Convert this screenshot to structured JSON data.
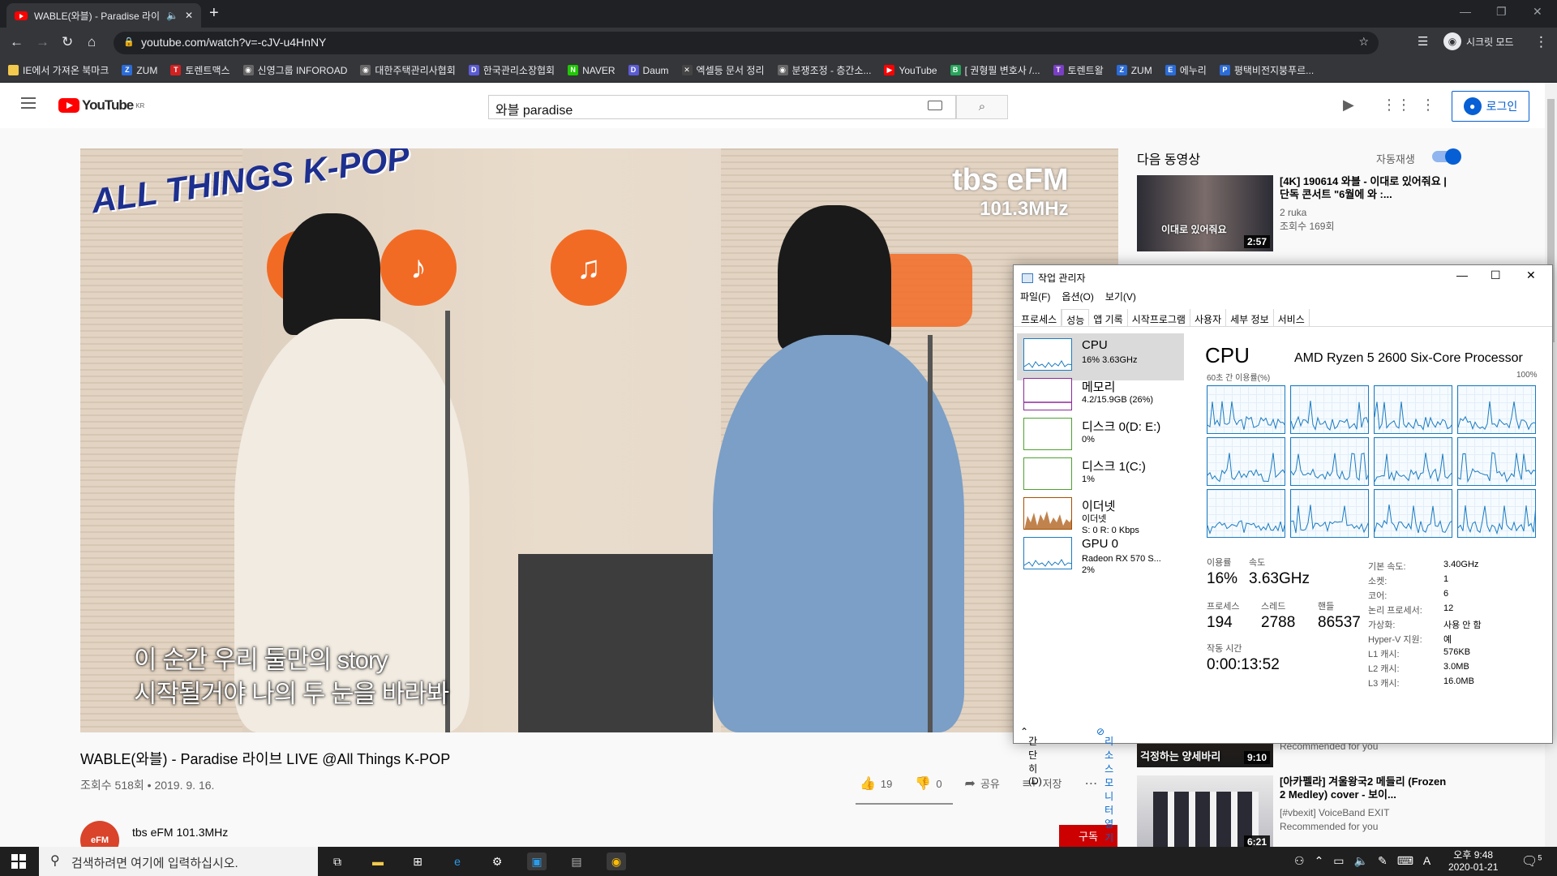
{
  "browser": {
    "tab_title": "WABLE(와블) - Paradise 라이",
    "url": "youtube.com/watch?v=-cJV-u4HnNY",
    "incognito_label": "시크릿 모드",
    "bookmarks": [
      {
        "label": "IE에서 가져온 북마크",
        "icon": "folder-icon",
        "color": "#f2c94c",
        "glyph": ""
      },
      {
        "label": "ZUM",
        "icon": "zum-icon",
        "color": "#2b6cd8",
        "glyph": "Z"
      },
      {
        "label": "토렌트맥스",
        "icon": "torrent-icon",
        "color": "#d42020",
        "glyph": "T"
      },
      {
        "label": "신영그룹 INFOROAD",
        "icon": "globe-icon",
        "color": "#666666",
        "glyph": "◉"
      },
      {
        "label": "대한주택관리사협회",
        "icon": "globe-icon",
        "color": "#666666",
        "glyph": "◉"
      },
      {
        "label": "한국관리소장협회",
        "icon": "d-icon",
        "color": "#5b5bd6",
        "glyph": "D"
      },
      {
        "label": "NAVER",
        "icon": "naver-icon",
        "color": "#1ec800",
        "glyph": "N"
      },
      {
        "label": "Daum",
        "icon": "daum-icon",
        "color": "#5b5bd6",
        "glyph": "D"
      },
      {
        "label": "엑셀등 문서 정리",
        "icon": "tool-icon",
        "color": "#444444",
        "glyph": "✕"
      },
      {
        "label": "분쟁조정 - 층간소...",
        "icon": "globe-icon",
        "color": "#666666",
        "glyph": "◉"
      },
      {
        "label": "YouTube",
        "icon": "youtube-icon",
        "color": "#ff0000",
        "glyph": "▶"
      },
      {
        "label": "[ 권형필 변호사 /...",
        "icon": "blog-icon",
        "color": "#26a65b",
        "glyph": "B"
      },
      {
        "label": "토렌트왈",
        "icon": "torrent-icon",
        "color": "#7a3fc4",
        "glyph": "T"
      },
      {
        "label": "ZUM",
        "icon": "zum-icon",
        "color": "#2b6cd8",
        "glyph": "Z"
      },
      {
        "label": "에누리",
        "icon": "enuri-icon",
        "color": "#2b6cd8",
        "glyph": "E"
      },
      {
        "label": "평택비전지붕푸르...",
        "icon": "site-icon",
        "color": "#2b6cd8",
        "glyph": "P"
      }
    ]
  },
  "youtube": {
    "logo_text": "YouTube",
    "logo_region": "KR",
    "search_query": "와블 paradise",
    "login_label": "로그인",
    "video": {
      "overlay_brand_left": "ALL THINGS K-POP",
      "overlay_brand_right_1": "tbs eFM",
      "overlay_brand_right_2": "101.3MHz",
      "subtitle_line1": "이 순간 우리 둘만의 story",
      "subtitle_line2": "시작될거야 나의 두 눈을 바라봐"
    },
    "title": "WABLE(와블) - Paradise 라이브 LIVE @All Things K-POP",
    "views_date": "조회수 518회 • 2019. 9. 16.",
    "likes": "19",
    "dislikes": "0",
    "share_label": "공유",
    "save_label": "저장",
    "channel_name": "tbs eFM 101.3MHz",
    "channel_avatar_text": "eFM",
    "subscribe_label": "구독",
    "up_next_label": "다음 동영상",
    "autoplay_label": "자동재생",
    "recommendations": [
      {
        "title": "[4K] 190614 와블 - 이대로 있어줘요 | 단독 콘서트 \"6월에 와 :...",
        "channel": "2 ruka",
        "meta": "조회수 169회",
        "duration": "2:57",
        "thumb_text": "이대로 있어줘요"
      },
      {
        "title": "",
        "channel": "",
        "meta": "Recommended for you",
        "duration": "9:10",
        "thumb_text": "걱정하는 양세바리"
      },
      {
        "title": "[아카펠라] 겨울왕국2 메들리 (Frozen 2 Medley) cover - 보이...",
        "channel": "[#vbexit] VoiceBand EXIT",
        "meta": "Recommended for you",
        "duration": "6:21",
        "thumb_text": ""
      }
    ]
  },
  "task_manager": {
    "title": "작업 관리자",
    "menu": [
      "파일(F)",
      "옵션(O)",
      "보기(V)"
    ],
    "tabs": [
      "프로세스",
      "성능",
      "앱 기록",
      "시작프로그램",
      "사용자",
      "세부 정보",
      "서비스"
    ],
    "active_tab": "성능",
    "resources": [
      {
        "name": "CPU",
        "sub1": "16% 3.63GHz",
        "sub2": "",
        "sub3": "",
        "color": "#1b7cc2"
      },
      {
        "name": "메모리",
        "sub1": "4.2/15.9GB (26%)",
        "sub2": "",
        "sub3": "",
        "color": "#8b2a9b"
      },
      {
        "name": "디스크 0(D: E:)",
        "sub1": "0%",
        "sub2": "",
        "sub3": "",
        "color": "#4da32f"
      },
      {
        "name": "디스크 1(C:)",
        "sub1": "1%",
        "sub2": "",
        "sub3": "",
        "color": "#4da32f"
      },
      {
        "name": "이더넷",
        "sub1": "이더넷",
        "sub2": "S: 0 R: 0 Kbps",
        "sub3": "",
        "color": "#a74f01"
      },
      {
        "name": "GPU 0",
        "sub1": "Radeon RX 570 S...",
        "sub2": "2%",
        "sub3": "",
        "color": "#1b7cc2"
      }
    ],
    "cpu_title": "CPU",
    "cpu_model": "AMD Ryzen 5 2600 Six-Core Processor",
    "graph_caption": "60초 간 이용률(%)",
    "graph_max": "100%",
    "stats": {
      "util_label": "이용률",
      "util_value": "16%",
      "speed_label": "속도",
      "speed_value": "3.63GHz",
      "proc_label": "프로세스",
      "proc_value": "194",
      "thread_label": "스레드",
      "thread_value": "2788",
      "handle_label": "핸들",
      "handle_value": "86537",
      "uptime_label": "작동 시간",
      "uptime_value": "0:00:13:52"
    },
    "specs": [
      {
        "k": "기본 속도:",
        "v": "3.40GHz"
      },
      {
        "k": "소켓:",
        "v": "1"
      },
      {
        "k": "코어:",
        "v": "6"
      },
      {
        "k": "논리 프로세서:",
        "v": "12"
      },
      {
        "k": "가상화:",
        "v": "사용 안 함"
      },
      {
        "k": "Hyper-V 지원:",
        "v": "예"
      },
      {
        "k": "L1 캐시:",
        "v": "576KB"
      },
      {
        "k": "L2 캐시:",
        "v": "3.0MB"
      },
      {
        "k": "L3 캐시:",
        "v": "16.0MB"
      }
    ],
    "fewer_details": "간단히(D)",
    "resource_monitor": "리소스 모니터 열기"
  },
  "taskbar": {
    "search_placeholder": "검색하려면 여기에 입력하십시오.",
    "time": "오후 9:48",
    "date": "2020-01-21",
    "ime": "A",
    "notifications": "5"
  }
}
